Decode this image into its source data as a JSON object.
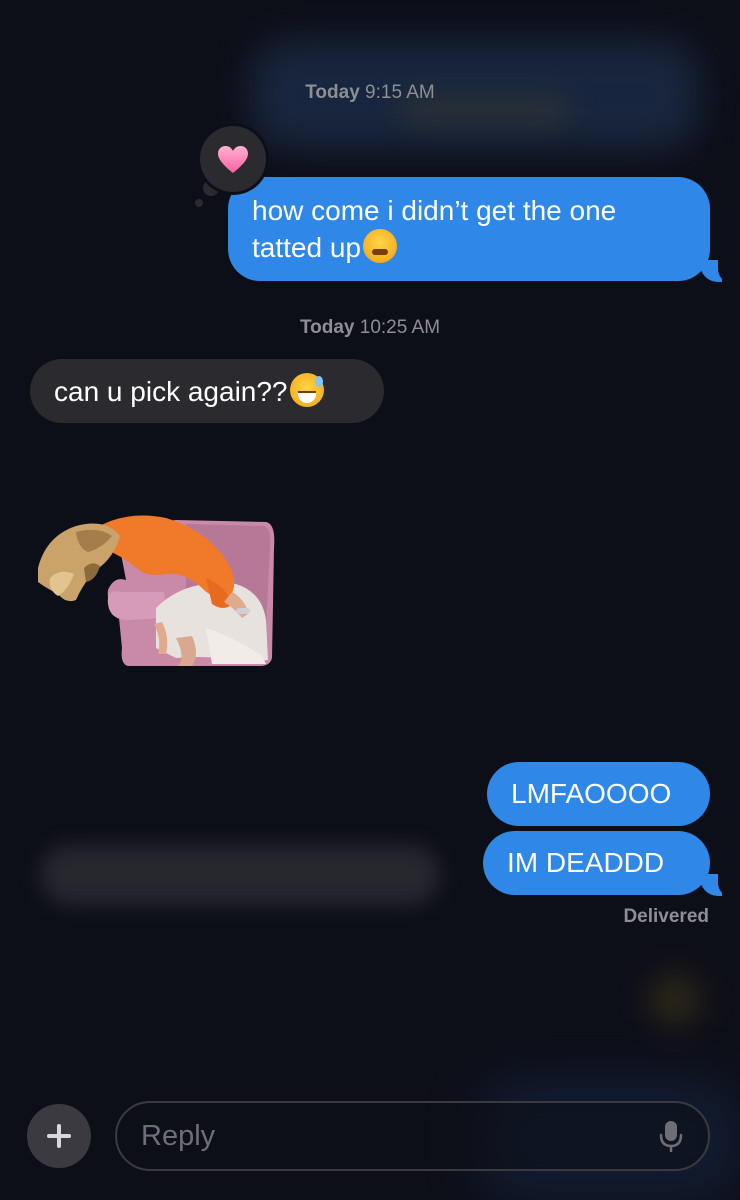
{
  "colors": {
    "background": "#0d0f18",
    "outgoing_bubble": "#2f87e8",
    "incoming_bubble": "#2a2a2f",
    "meta_text": "#8e8e95"
  },
  "timestamps": [
    {
      "day": "Today",
      "time": "9:15 AM"
    },
    {
      "day": "Today",
      "time": "10:25 AM"
    }
  ],
  "messages": {
    "msg1": {
      "text": "how come i didn’t get the one\ntatted up",
      "emoji": "face-with-steam-from-nose",
      "direction": "outgoing",
      "reaction": "heart"
    },
    "msg2": {
      "text": "can u pick again??",
      "emoji": "grinning-face-with-sweat",
      "direction": "incoming"
    },
    "msg3": {
      "type": "sticker",
      "direction": "incoming"
    },
    "msg4": {
      "text": "LMFAOOOO",
      "direction": "outgoing"
    },
    "msg5": {
      "text": "IM DEADDD",
      "direction": "outgoing"
    }
  },
  "status": {
    "delivered": "Delivered"
  },
  "input": {
    "placeholder": "Reply",
    "add_icon": "plus-icon",
    "mic_icon": "microphone-icon"
  }
}
